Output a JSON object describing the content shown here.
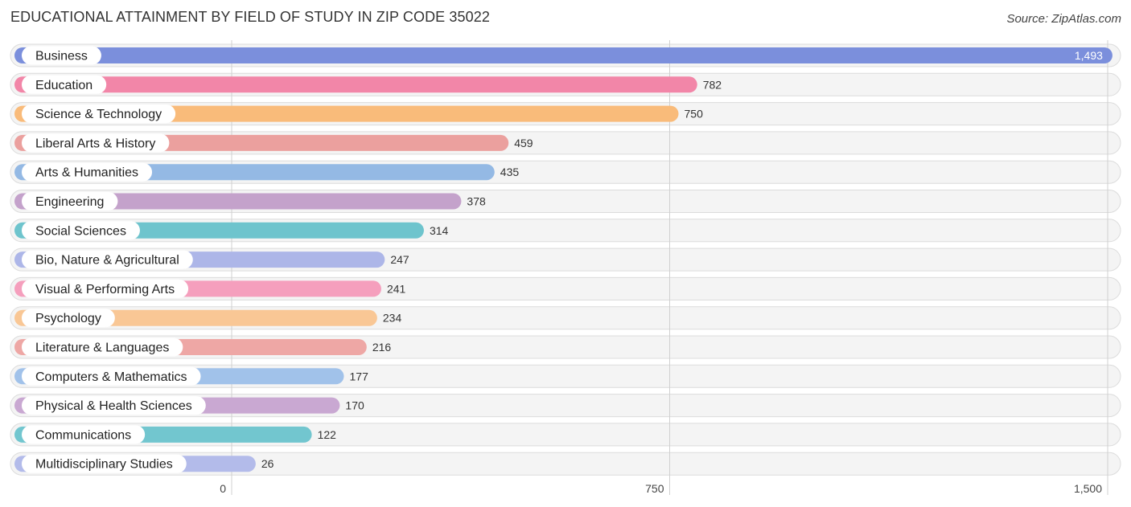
{
  "header": {
    "title": "EDUCATIONAL ATTAINMENT BY FIELD OF STUDY IN ZIP CODE 35022",
    "source": "Source: ZipAtlas.com"
  },
  "chart_data": {
    "type": "bar",
    "orientation": "horizontal",
    "title": "EDUCATIONAL ATTAINMENT BY FIELD OF STUDY IN ZIP CODE 35022",
    "xlabel": "",
    "ylabel": "",
    "xlim": [
      0,
      1500
    ],
    "grid": true,
    "ticks": [
      0,
      750,
      1500
    ],
    "tick_labels": [
      "0",
      "750",
      "1,500"
    ],
    "categories": [
      "Business",
      "Education",
      "Science & Technology",
      "Liberal Arts & History",
      "Arts & Humanities",
      "Engineering",
      "Social Sciences",
      "Bio, Nature & Agricultural",
      "Visual & Performing Arts",
      "Psychology",
      "Literature & Languages",
      "Computers & Mathematics",
      "Physical & Health Sciences",
      "Communications",
      "Multidisciplinary Studies"
    ],
    "values": [
      1493,
      782,
      750,
      459,
      435,
      378,
      314,
      247,
      241,
      234,
      216,
      177,
      170,
      122,
      26
    ],
    "value_labels": [
      "1,493",
      "782",
      "750",
      "459",
      "435",
      "378",
      "314",
      "247",
      "241",
      "234",
      "216",
      "177",
      "170",
      "122",
      "26"
    ],
    "colors": [
      "#7b8fdc",
      "#f286a8",
      "#f9bb7a",
      "#eba09e",
      "#94b9e4",
      "#c4a2cb",
      "#6ec4cd",
      "#adb6e8",
      "#f59fbd",
      "#f9c795",
      "#eea7a5",
      "#a1c2ea",
      "#c9a8d2",
      "#72c6cf",
      "#b3bbea"
    ]
  }
}
